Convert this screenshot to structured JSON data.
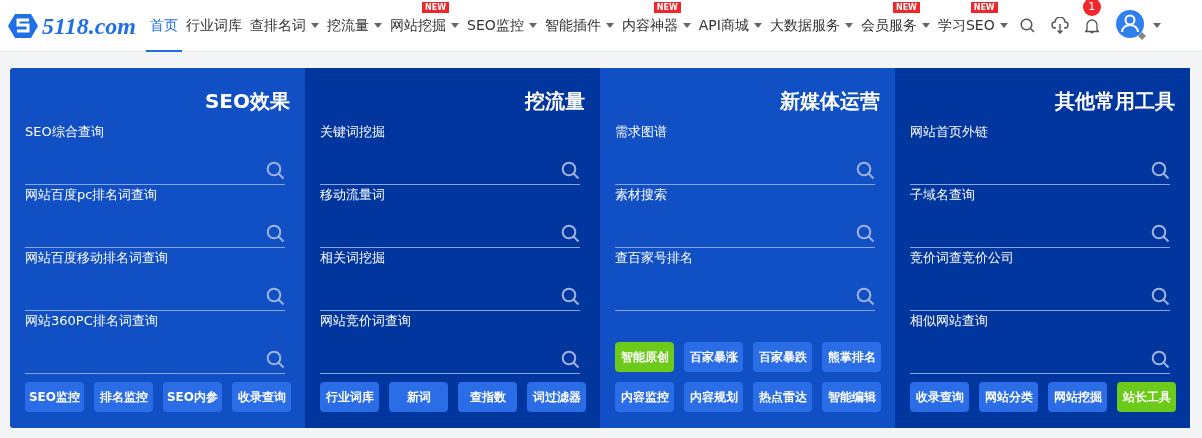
{
  "header": {
    "logo": "5118.com",
    "nav": [
      {
        "label": "首页",
        "selected": true,
        "dropdown": false
      },
      {
        "label": "行业词库",
        "selected": false,
        "dropdown": false
      },
      {
        "label": "查排名词",
        "selected": false,
        "dropdown": true
      },
      {
        "label": "挖流量",
        "selected": false,
        "dropdown": true
      },
      {
        "label": "网站挖掘",
        "selected": false,
        "dropdown": true,
        "badge": "NEW"
      },
      {
        "label": "SEO监控",
        "selected": false,
        "dropdown": true
      },
      {
        "label": "智能插件",
        "selected": false,
        "dropdown": true
      },
      {
        "label": "内容神器",
        "selected": false,
        "dropdown": true,
        "badge": "NEW"
      },
      {
        "label": "API商城",
        "selected": false,
        "dropdown": true
      },
      {
        "label": "大数据服务",
        "selected": false,
        "dropdown": true
      },
      {
        "label": "会员服务",
        "selected": false,
        "dropdown": true,
        "badge": "NEW"
      },
      {
        "label": "学习SEO",
        "selected": false,
        "dropdown": true,
        "badge": "NEW"
      }
    ],
    "notification_count": "1"
  },
  "columns": [
    {
      "title": "SEO效果",
      "fields": [
        "SEO综合查询",
        "网站百度pc排名词查询",
        "网站百度移动排名词查询",
        "网站360PC排名词查询"
      ],
      "buttons": [
        {
          "label": "SEO监控",
          "highlight": false
        },
        {
          "label": "排名监控",
          "highlight": false
        },
        {
          "label": "SEO内参",
          "highlight": false
        },
        {
          "label": "收录查询",
          "highlight": false
        }
      ]
    },
    {
      "title": "挖流量",
      "fields": [
        "关键词挖掘",
        "移动流量词",
        "相关词挖掘",
        "网站竞价词查询"
      ],
      "buttons": [
        {
          "label": "行业词库",
          "highlight": false
        },
        {
          "label": "新词",
          "highlight": false
        },
        {
          "label": "查指数",
          "highlight": false
        },
        {
          "label": "词过滤器",
          "highlight": false
        }
      ]
    },
    {
      "title": "新媒体运营",
      "fields": [
        "需求图谱",
        "素材搜索",
        "查百家号排名"
      ],
      "buttons": [
        {
          "label": "智能原创",
          "highlight": true
        },
        {
          "label": "百家暴涨",
          "highlight": false
        },
        {
          "label": "百家暴跌",
          "highlight": false
        },
        {
          "label": "熊掌排名",
          "highlight": false
        },
        {
          "label": "内容监控",
          "highlight": false
        },
        {
          "label": "内容规划",
          "highlight": false
        },
        {
          "label": "热点雷达",
          "highlight": false
        },
        {
          "label": "智能编辑",
          "highlight": false
        }
      ]
    },
    {
      "title": "其他常用工具",
      "fields": [
        "网站首页外链",
        "子域名查询",
        "竞价词查竞价公司",
        "相似网站查询"
      ],
      "buttons": [
        {
          "label": "收录查询",
          "highlight": false
        },
        {
          "label": "网站分类",
          "highlight": false
        },
        {
          "label": "网站挖掘",
          "highlight": false
        },
        {
          "label": "站长工具",
          "highlight": true
        }
      ]
    }
  ]
}
